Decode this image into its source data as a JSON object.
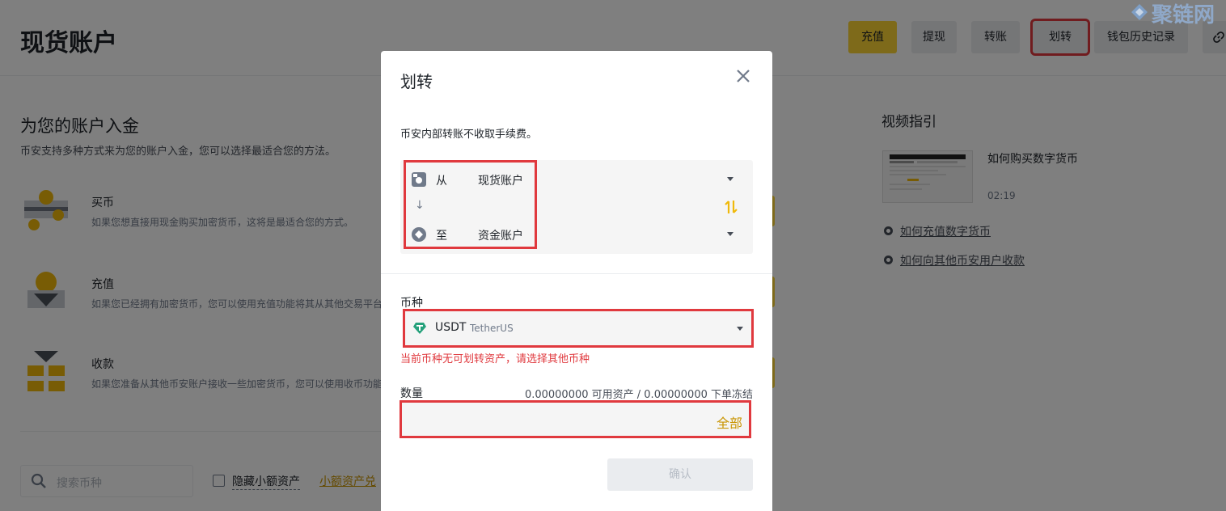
{
  "header": {
    "title": "现货账户",
    "buttons": [
      {
        "label": "充值",
        "primary": true
      },
      {
        "label": "提现"
      },
      {
        "label": "转账"
      },
      {
        "label": "划转",
        "highlighted": true
      },
      {
        "label": "钱包历史记录"
      }
    ],
    "link_icon": "link-icon"
  },
  "deposit_section": {
    "title": "为您的账户入金",
    "description": "币安支持多种方式来为您的账户入金，您可以选择最适合您的方法。",
    "methods": [
      {
        "name": "买币",
        "description": "如果您想直接用现金购买加密货币，这将是最适合您的方式。",
        "icon": "buy-coin-icon"
      },
      {
        "name": "充值",
        "description": "如果您已经拥有加密货币，您可以使用充值功能将其从其他交易平台",
        "icon": "deposit-icon"
      },
      {
        "name": "收款",
        "description": "如果您准备从其他币安账户接收一些加密货币，您可以使用收币功能",
        "icon": "receive-icon"
      }
    ]
  },
  "toolbar": {
    "search_placeholder": "搜索币种",
    "hide_small_label": "隐藏小额资产",
    "small_convert_link": "小额资产兑"
  },
  "video_guide": {
    "title": "视频指引",
    "video_name": "如何购买数字货币",
    "video_duration": "02:19",
    "links": [
      "如何充值数字货币",
      "如何向其他币安用户收款"
    ]
  },
  "watermark": "聚链网",
  "modal": {
    "title": "划转",
    "note": "币安内部转账不收取手续费。",
    "from_label": "从",
    "from_account": "现货账户",
    "to_label": "至",
    "to_account": "资金账户",
    "down_arrow": "↓",
    "coin_label": "币种",
    "coin_symbol": "USDT",
    "coin_name": "TetherUS",
    "coin_error": "当前币种无可划转资产，请选择其他币种",
    "quantity_label": "数量",
    "quantity_info": "0.00000000 可用资产 / 0.00000000 下单冻结",
    "quantity_value": "",
    "all_label": "全部",
    "confirm_label": "确认",
    "close_symbol": "✕"
  },
  "colors": {
    "brand_yellow": "#fcd535",
    "highlight_red": "#e0393e",
    "link_gold": "#c99400",
    "tether_green": "#26a17b"
  }
}
